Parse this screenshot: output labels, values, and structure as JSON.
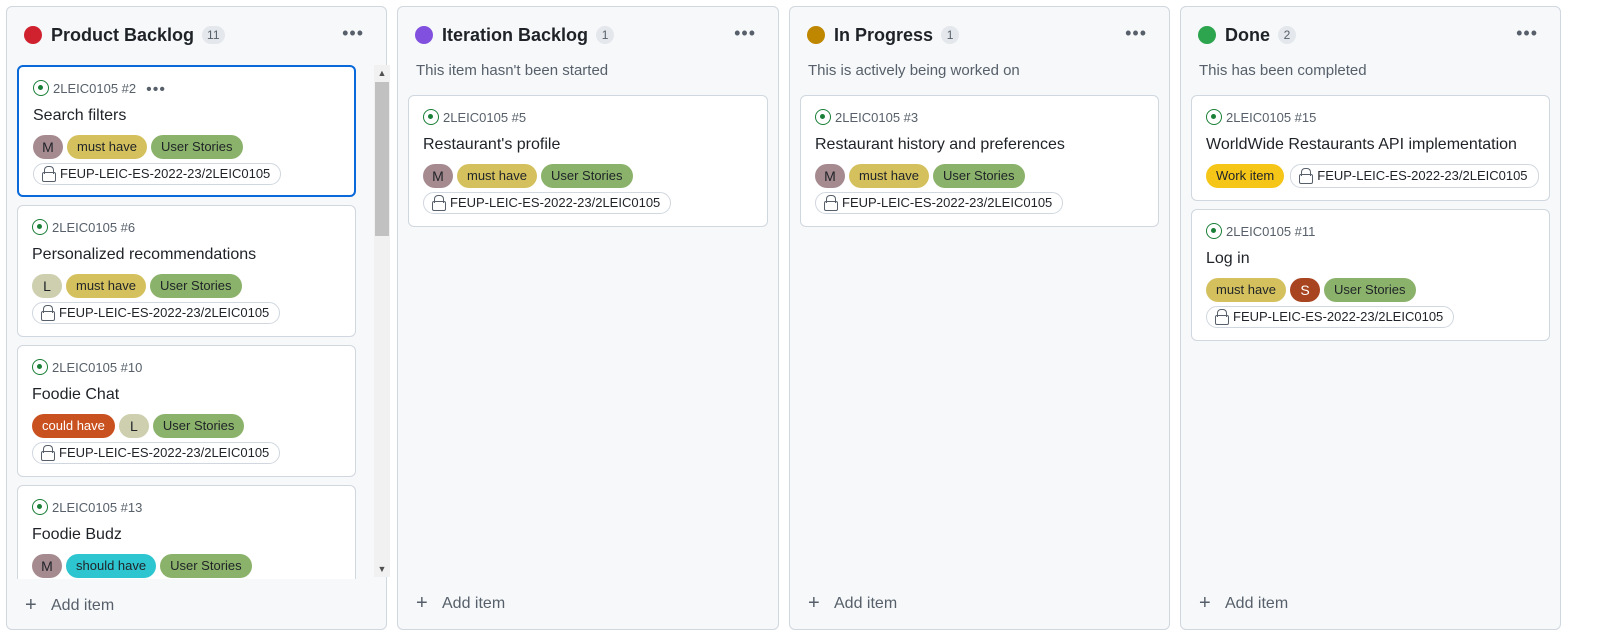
{
  "colors": {
    "must_have": "#d4c15e",
    "could_have": "#c9511f",
    "should_have": "#2dc5cf",
    "user_stories": "#8bb26a",
    "work_item": "#f5c518",
    "avatar_m": "#a58a8f",
    "avatar_l": "#cdcfae",
    "avatar_s": "#a8441f"
  },
  "columns": [
    {
      "title": "Product Backlog",
      "count": "11",
      "color": "#cf222e",
      "description": "",
      "add_label": "Add item",
      "cards": [
        {
          "issue": "2LEIC0105 #2",
          "title": "Search filters",
          "repo": "FEUP-LEIC-ES-2022-23/2LEIC0105",
          "labels": [
            {
              "kind": "avatar",
              "text": "M"
            },
            {
              "kind": "label",
              "text": "must have"
            },
            {
              "kind": "label",
              "text": "User Stories"
            }
          ]
        },
        {
          "issue": "2LEIC0105 #6",
          "title": "Personalized recommendations",
          "repo": "FEUP-LEIC-ES-2022-23/2LEIC0105",
          "labels": [
            {
              "kind": "avatar",
              "text": "L"
            },
            {
              "kind": "label",
              "text": "must have"
            },
            {
              "kind": "label",
              "text": "User Stories"
            }
          ]
        },
        {
          "issue": "2LEIC0105 #10",
          "title": "Foodie Chat",
          "repo": "FEUP-LEIC-ES-2022-23/2LEIC0105",
          "labels": [
            {
              "kind": "label",
              "text": "could have"
            },
            {
              "kind": "avatar",
              "text": "L"
            },
            {
              "kind": "label",
              "text": "User Stories"
            }
          ]
        },
        {
          "issue": "2LEIC0105 #13",
          "title": "Foodie Budz",
          "repo": "",
          "labels": [
            {
              "kind": "avatar",
              "text": "M"
            },
            {
              "kind": "label",
              "text": "should have"
            },
            {
              "kind": "label",
              "text": "User Stories"
            }
          ]
        }
      ]
    },
    {
      "title": "Iteration Backlog",
      "count": "1",
      "color": "#8250df",
      "description": "This item hasn't been started",
      "add_label": "Add item",
      "cards": [
        {
          "issue": "2LEIC0105 #5",
          "title": "Restaurant's profile",
          "repo": "FEUP-LEIC-ES-2022-23/2LEIC0105",
          "labels": [
            {
              "kind": "avatar",
              "text": "M"
            },
            {
              "kind": "label",
              "text": "must have"
            },
            {
              "kind": "label",
              "text": "User Stories"
            }
          ]
        }
      ]
    },
    {
      "title": "In Progress",
      "count": "1",
      "color": "#bf8700",
      "description": "This is actively being worked on",
      "add_label": "Add item",
      "cards": [
        {
          "issue": "2LEIC0105 #3",
          "title": "Restaurant history and preferences",
          "repo": "FEUP-LEIC-ES-2022-23/2LEIC0105",
          "labels": [
            {
              "kind": "avatar",
              "text": "M"
            },
            {
              "kind": "label",
              "text": "must have"
            },
            {
              "kind": "label",
              "text": "User Stories"
            }
          ]
        }
      ]
    },
    {
      "title": "Done",
      "count": "2",
      "color": "#2da44e",
      "description": "This has been completed",
      "add_label": "Add item",
      "cards": [
        {
          "issue": "2LEIC0105 #15",
          "title": "WorldWide Restaurants API implementation",
          "repo": "FEUP-LEIC-ES-2022-23/2LEIC0105",
          "labels": [
            {
              "kind": "label",
              "text": "Work item"
            }
          ]
        },
        {
          "issue": "2LEIC0105 #11",
          "title": "Log in",
          "repo": "FEUP-LEIC-ES-2022-23/2LEIC0105",
          "labels": [
            {
              "kind": "label",
              "text": "must have"
            },
            {
              "kind": "avatar",
              "text": "S"
            },
            {
              "kind": "label",
              "text": "User Stories"
            }
          ]
        }
      ]
    }
  ]
}
